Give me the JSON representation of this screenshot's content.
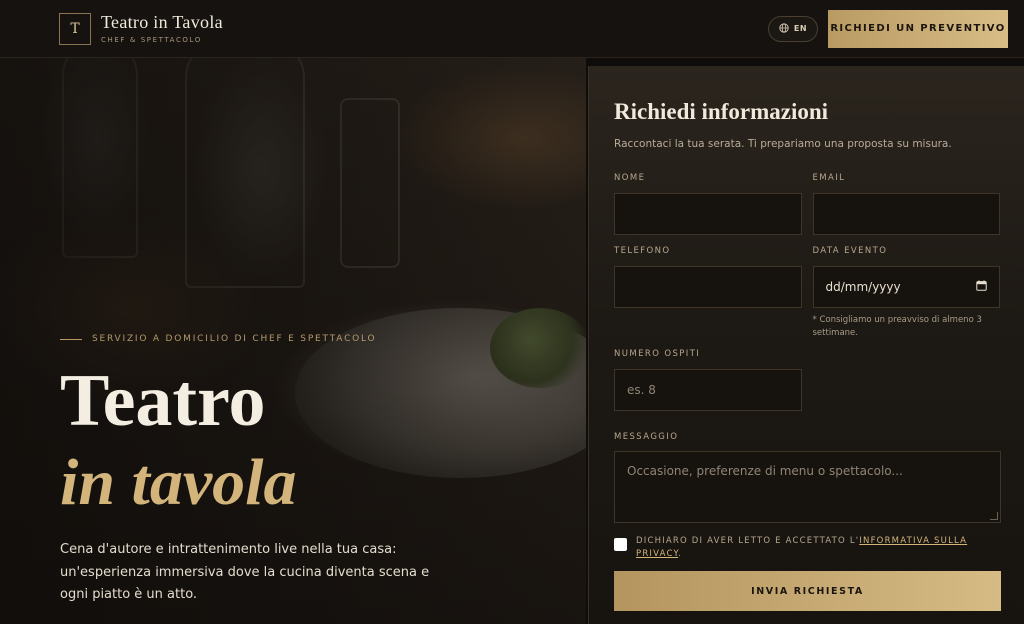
{
  "header": {
    "logo_letter": "T",
    "title": "Teatro in Tavola",
    "subtitle": "CHEF & SPETTACOLO",
    "lang_label": "EN",
    "cta_label": "RICHIEDI UN PREVENTIVO"
  },
  "hero": {
    "kicker": "SERVIZIO A DOMICILIO DI CHEF E SPETTACOLO",
    "title_line1": "Teatro",
    "title_line2": "in tavola",
    "description": "Cena d'autore e intrattenimento live nella tua casa: un'esperienza immersiva dove la cucina diventa scena e ogni piatto è un atto."
  },
  "form": {
    "title": "Richiedi informazioni",
    "subtitle": "Raccontaci la tua serata. Ti prepariamo una proposta su misura.",
    "name_label": "NOME",
    "name_value": "",
    "email_label": "EMAIL",
    "email_value": "",
    "phone_label": "TELEFONO",
    "phone_value": "",
    "date_label": "DATA EVENTO",
    "date_value": "dd/mm/yyyy",
    "date_hint": "* Consigliamo un preavviso di almeno 3 settimane.",
    "guests_label": "NUMERO OSPITI",
    "guests_placeholder": "es. 8",
    "message_label": "MESSAGGIO",
    "message_placeholder": "Occasione, preferenze di menu o spettacolo...",
    "consent_text": "DICHIARO DI AVER LETTO E ACCETTATO L'",
    "consent_link": "INFORMATIVA SULLA PRIVACY",
    "consent_end": ".",
    "consent_checked": false,
    "submit_label": "INVIA RICHIESTA"
  },
  "colors": {
    "accent_gold": "#d3b57c",
    "background": "#0f0d0b",
    "panel": "#1d1914"
  },
  "icons": {
    "lang": "globe-icon",
    "date": "calendar-icon"
  }
}
